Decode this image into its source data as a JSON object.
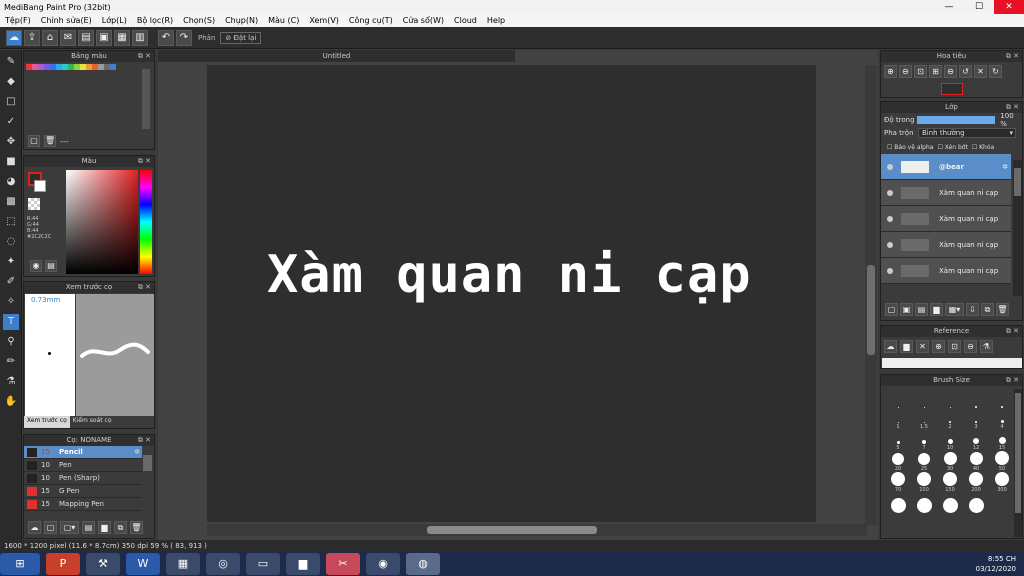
{
  "app": {
    "title": "MediBang Paint Pro (32bit)"
  },
  "window": {
    "minimize": "—",
    "maximize": "☐",
    "close": "✕"
  },
  "menu": [
    "Tệp(F)",
    "Chỉnh sửa(E)",
    "Lớp(L)",
    "Bộ lọc(R)",
    "Chọn(S)",
    "Chụp(N)",
    "Màu (C)",
    "Xem(V)",
    "Công cụ(T)",
    "Cửa sổ(W)",
    "Cloud",
    "Help"
  ],
  "toolbar": {
    "snap_label": "Phân",
    "reset_label": "Đặt lại"
  },
  "panels": {
    "palette": {
      "title": "Bảng màu",
      "dash": "---"
    },
    "color": {
      "title": "Màu",
      "r": "R:44",
      "g": "G:44",
      "b": "B:44",
      "hex": "#2C2C2C"
    },
    "brush_preview": {
      "title": "Xem trước cọ",
      "size": "0.73mm",
      "tab1": "Xem trước cọ",
      "tab2": "Kiểm soát cọ"
    },
    "brushes": {
      "title": "Cọ: NONAME",
      "items": [
        {
          "size": "15",
          "name": "Pencil"
        },
        {
          "size": "10",
          "name": "Pen"
        },
        {
          "size": "10",
          "name": "Pen (Sharp)"
        },
        {
          "size": "15",
          "name": "G Pen"
        },
        {
          "size": "15",
          "name": "Mapping Pen"
        }
      ]
    },
    "navigator": {
      "title": "Hoa tiêu"
    },
    "layers": {
      "title": "Lớp",
      "opacity_label": "Độ trong",
      "opacity_value": "100 %",
      "blend_label": "Pha trộn",
      "blend_value": "Bình thường",
      "protect_alpha": "Bảo vệ alpha",
      "clipping": "Xén bớt",
      "lock": "Khóa",
      "items": [
        {
          "name": "@bear"
        },
        {
          "name": "Xàm quan ni cạp"
        },
        {
          "name": "Xàm quan ni cạp"
        },
        {
          "name": "Xàm quan ni cạp"
        },
        {
          "name": "Xàm quan ni cạp"
        }
      ]
    },
    "reference": {
      "title": "Reference"
    },
    "brush_size": {
      "title": "Brush Size",
      "sizes": [
        "",
        "",
        "",
        "",
        "",
        "1",
        "1.5",
        "2",
        "3",
        "4",
        "5",
        "7",
        "10",
        "12",
        "15",
        "20",
        "25",
        "30",
        "40",
        "50",
        "70",
        "100",
        "150",
        "200",
        "300",
        "",
        "",
        "",
        "",
        ""
      ]
    }
  },
  "document": {
    "tab": "Untitled",
    "canvas_text": "Xàm quan ni cạp"
  },
  "status": {
    "text": "1600 * 1200 pixel   (11.6 * 8.7cm)   350 dpi   59 %   ( 83, 913 )"
  },
  "clock": {
    "time": "8:55 CH",
    "date": "03/12/2020"
  },
  "colors": {
    "accent": "#3d7fc9",
    "layer_selected": "#5b8dc9"
  }
}
